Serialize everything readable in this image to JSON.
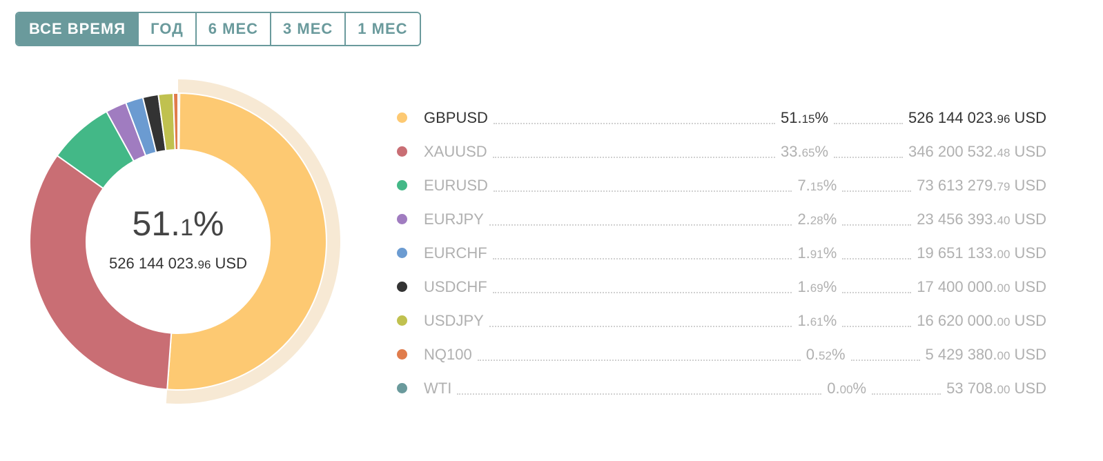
{
  "tabs": [
    "ВСЕ ВРЕМЯ",
    "ГОД",
    "6 МЕС",
    "3 МЕС",
    "1 МЕС"
  ],
  "center": {
    "pct_int": "51.",
    "pct_dec": "1",
    "pct_sym": "%",
    "amount_int": "526 144 023.",
    "amount_dec": "96",
    "currency": " USD"
  },
  "colors": {
    "highlight_ring": "#f7e9d4"
  },
  "chart_data": {
    "type": "pie",
    "variant": "donut",
    "selected": "GBPUSD",
    "currency": "USD",
    "series": [
      {
        "name": "GBPUSD",
        "pct_int": "51.",
        "pct_dec": "15",
        "amt_int": "526 144 023.",
        "amt_dec": "96",
        "value": 51.15,
        "amount": 526144023.96,
        "color": "#fdc972"
      },
      {
        "name": "XAUUSD",
        "pct_int": "33.",
        "pct_dec": "65",
        "amt_int": "346 200 532.",
        "amt_dec": "48",
        "value": 33.65,
        "amount": 346200532.48,
        "color": "#c96e74"
      },
      {
        "name": "EURUSD",
        "pct_int": "7.",
        "pct_dec": "15",
        "amt_int": "73 613 279.",
        "amt_dec": "79",
        "value": 7.15,
        "amount": 73613279.79,
        "color": "#43b887"
      },
      {
        "name": "EURJPY",
        "pct_int": "2.",
        "pct_dec": "28",
        "amt_int": "23 456 393.",
        "amt_dec": "40",
        "value": 2.28,
        "amount": 23456393.4,
        "color": "#a07cc0"
      },
      {
        "name": "EURCHF",
        "pct_int": "1.",
        "pct_dec": "91",
        "amt_int": "19 651 133.",
        "amt_dec": "00",
        "value": 1.91,
        "amount": 19651133.0,
        "color": "#6b9bd1"
      },
      {
        "name": "USDCHF",
        "pct_int": "1.",
        "pct_dec": "69",
        "amt_int": "17 400 000.",
        "amt_dec": "00",
        "value": 1.69,
        "amount": 17400000.0,
        "color": "#333333"
      },
      {
        "name": "USDJPY",
        "pct_int": "1.",
        "pct_dec": "61",
        "amt_int": "16 620 000.",
        "amt_dec": "00",
        "value": 1.61,
        "amount": 16620000.0,
        "color": "#c0c14f"
      },
      {
        "name": "NQ100",
        "pct_int": "0.",
        "pct_dec": "52",
        "amt_int": "5 429 380.",
        "amt_dec": "00",
        "value": 0.52,
        "amount": 5429380.0,
        "color": "#e07c4c"
      },
      {
        "name": "WTI",
        "pct_int": "0.",
        "pct_dec": "00",
        "amt_int": "53 708.",
        "amt_dec": "00",
        "value": 0.0,
        "amount": 53708.0,
        "color": "#6a9a9c"
      }
    ]
  }
}
